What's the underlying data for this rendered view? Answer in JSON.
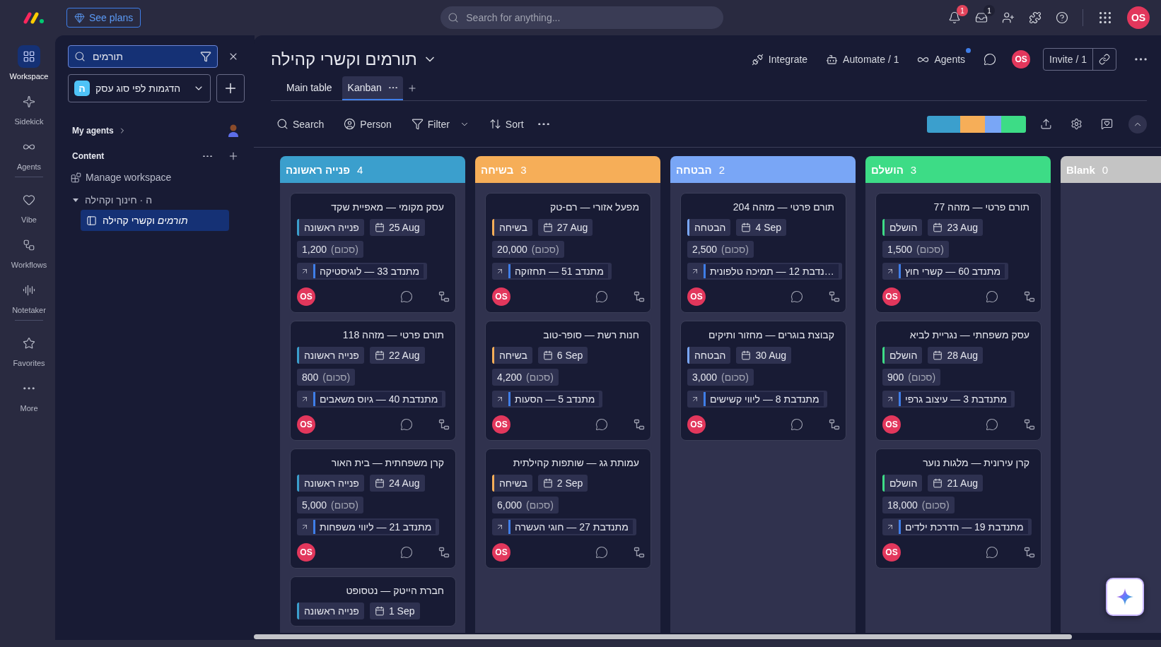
{
  "top_bar": {
    "upgrade_button": "See plans",
    "search": {
      "placeholder": "Search for anything..."
    },
    "notifications_badge": "1",
    "inbox_badge": "1",
    "avatar": "OS"
  },
  "rail": {
    "items": [
      {
        "kind": "workspace",
        "label": "Workspace",
        "selected": true
      },
      {
        "kind": "sidekick",
        "label": "Sidekick",
        "selected": false
      },
      {
        "kind": "agents",
        "label": "Agents",
        "selected": false
      },
      {
        "kind": "divider"
      },
      {
        "kind": "vibe",
        "label": "Vibe",
        "selected": false
      },
      {
        "kind": "workflows",
        "label": "Workflows",
        "selected": false
      },
      {
        "kind": "notetaker",
        "label": "Notetaker",
        "selected": false
      },
      {
        "kind": "divider"
      },
      {
        "kind": "favorites",
        "label": "Favorites",
        "selected": false
      },
      {
        "kind": "more",
        "label": "More",
        "selected": false
      }
    ]
  },
  "sidebar": {
    "search": {
      "value": "תורמים"
    },
    "workspace": {
      "badge": "ה",
      "name": "הדגמות לפי סוג עסק"
    },
    "my_agents": "My agents",
    "content_heading": "Content",
    "manage": "Manage workspace",
    "folder": {
      "name": "ה · חינוך וקהילה",
      "expanded": true,
      "children": [
        {
          "name": "*תורמים* וקשרי קהילה",
          "selected": true
        }
      ]
    }
  },
  "board": {
    "title": "תורמים וקשרי קהילה",
    "actions": [
      {
        "kind": "agents",
        "label": "Agents",
        "dot": true
      },
      {
        "kind": "automate",
        "label": "Automate / 1"
      },
      {
        "kind": "integrate",
        "label": "Integrate"
      }
    ],
    "avatar": "OS",
    "invite": "Invite / 1",
    "views": [
      {
        "label": "Kanban",
        "selected": true
      },
      {
        "label": "Main table",
        "selected": false
      }
    ],
    "toolbar": [
      {
        "kind": "sort",
        "label": "Sort"
      },
      {
        "kind": "filter",
        "label": "Filter"
      },
      {
        "kind": "person",
        "label": "Person"
      },
      {
        "kind": "search",
        "label": "Search"
      }
    ],
    "columns": [
      {
        "name": "Blank",
        "count": "0",
        "color": "#c4c4c4"
      },
      {
        "name": "הושלם",
        "count": "3",
        "color": "#3ddc86",
        "cards": [
          {
            "title": "תורם פרטי — מזהה 77",
            "status": "הושלם",
            "date": "23 Aug",
            "amount": "1,500",
            "amount_label": "(סכום)",
            "volunteer": "מתנדב 60 — קשרי חוץ",
            "avatar": "OS"
          },
          {
            "title": "עסק משפחתי — נגריית לביא",
            "status": "הושלם",
            "date": "28 Aug",
            "amount": "900",
            "amount_label": "(סכום)",
            "volunteer": "מתנדבת 3 — עיצוב גרפי",
            "avatar": "OS"
          },
          {
            "title": "קרן עירונית — מלגות נוער",
            "status": "הושלם",
            "date": "21 Aug",
            "amount": "18,000",
            "amount_label": "(סכום)",
            "volunteer": "מתנדבת 19 — הדרכת ילדים",
            "avatar": "OS"
          }
        ]
      },
      {
        "name": "הבטחה",
        "count": "2",
        "color": "#79a6f6",
        "cards": [
          {
            "title": "תורם פרטי — מזהה 204",
            "status": "הבטחה",
            "date": "4 Sep",
            "amount": "2,500",
            "amount_label": "(סכום)",
            "volunteer": "…נדבת 12 — תמיכה טלפונית",
            "avatar": "OS"
          },
          {
            "title": "קבוצת בוגרים — מחזור ותיקים",
            "status": "הבטחה",
            "date": "30 Aug",
            "amount": "3,000",
            "amount_label": "(סכום)",
            "volunteer": "מתנדבת 8 — ליווי קשישים",
            "avatar": "OS"
          }
        ]
      },
      {
        "name": "בשיחה",
        "count": "3",
        "color": "#f6ae58",
        "cards": [
          {
            "title": "מפעל אזורי — רם-טק",
            "status": "בשיחה",
            "date": "27 Aug",
            "amount": "20,000",
            "amount_label": "(סכום)",
            "volunteer": "מתנדב 51 — תחזוקה",
            "avatar": "OS"
          },
          {
            "title": "חנות רשת — סופר-טוב",
            "status": "בשיחה",
            "date": "6 Sep",
            "amount": "4,200",
            "amount_label": "(סכום)",
            "volunteer": "מתנדב 5 — הסעות",
            "avatar": "OS"
          },
          {
            "title": "עמותת גג — שותפות קהילתית",
            "status": "בשיחה",
            "date": "2 Sep",
            "amount": "6,000",
            "amount_label": "(סכום)",
            "volunteer": "מתנדבת 27 — חוגי העשרה",
            "avatar": "OS"
          }
        ]
      },
      {
        "name": "פנייה ראשונה",
        "count": "4",
        "color": "#3b9fcd",
        "cards": [
          {
            "title": "עסק מקומי — מאפיית שקד",
            "status": "פנייה ראשונה",
            "date": "25 Aug",
            "amount": "1,200",
            "amount_label": "(סכום)",
            "volunteer": "מתנדב 33 — לוגיסטיקה",
            "avatar": "OS"
          },
          {
            "title": "תורם פרטי — מזהה 118",
            "status": "פנייה ראשונה",
            "date": "22 Aug",
            "amount": "800",
            "amount_label": "(סכום)",
            "volunteer": "מתנדבת 40 — גיוס משאבים",
            "avatar": "OS"
          },
          {
            "title": "קרן משפחתית — בית האור",
            "status": "פנייה ראשונה",
            "date": "24 Aug",
            "amount": "5,000",
            "amount_label": "(סכום)",
            "volunteer": "מתנדב 21 — ליווי משפחות",
            "avatar": "OS"
          },
          {
            "title": "חברת הייטק — נטסופט",
            "status": "פנייה ראשונה",
            "date": "1 Sep"
          }
        ]
      }
    ]
  }
}
